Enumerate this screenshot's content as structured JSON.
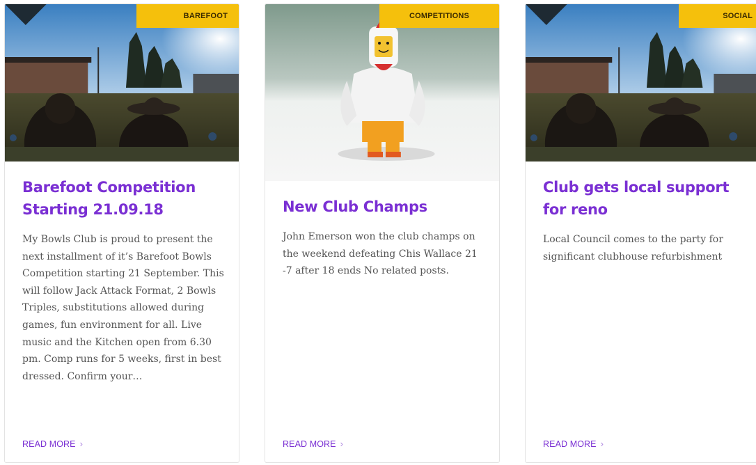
{
  "cards": [
    {
      "category": "BAREFOOT",
      "title": "Barefoot Competition Starting 21.09.18",
      "excerpt": "My Bowls Club is proud to present the next installment of it’s Barefoot Bowls Competition starting 21 September. This will follow Jack Attack Format, 2 Bowls Triples, substitutions allowed during games, fun environment for all. Live music and the Kitchen open from 6.30 pm. Comp runs for 5 weeks, first in best dressed. Confirm your…",
      "read_more": "READ MORE",
      "image": "bowls-green-photo"
    },
    {
      "category": "COMPETITIONS",
      "title": "New Club Champs",
      "excerpt": "John Emerson won the club champs on the weekend defeating Chis Wallace 21 -7 after 18 ends No related posts.",
      "read_more": "READ MORE",
      "image": "lego-chicken-photo"
    },
    {
      "category": "SOCIAL",
      "title": "Club gets local support for reno",
      "excerpt": "Local Council comes to the party for significant clubhouse refurbishment",
      "read_more": "READ MORE",
      "image": "bowls-green-photo"
    }
  ],
  "colors": {
    "accent": "#7a2fd3",
    "badge": "#f5c00c",
    "text": "#555555"
  }
}
